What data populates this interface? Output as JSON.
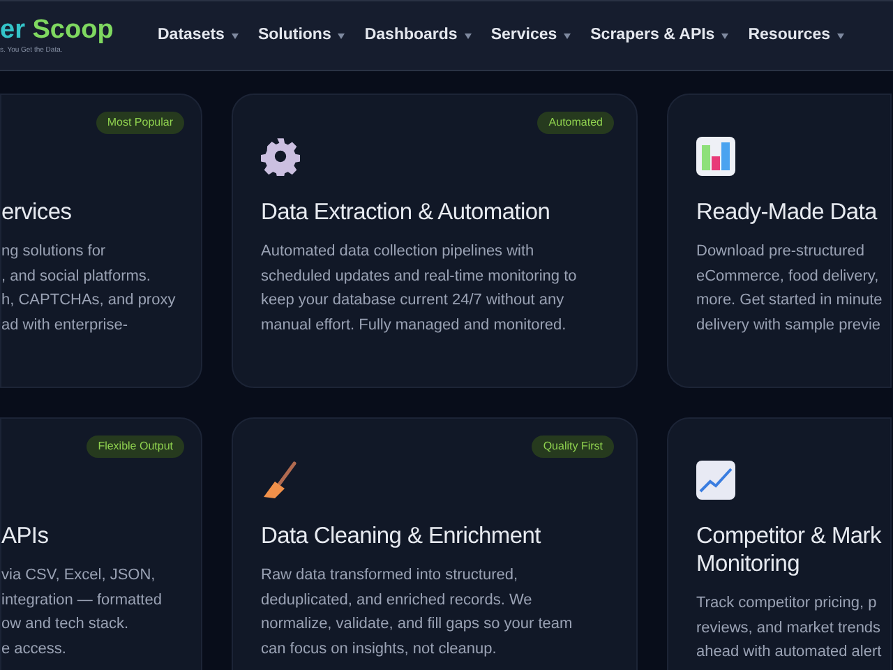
{
  "header": {
    "logo": {
      "part_1": "er",
      "part_2": "Scoop",
      "tagline": "s. You Get the Data."
    },
    "nav": [
      {
        "label": "Datasets"
      },
      {
        "label": "Solutions"
      },
      {
        "label": "Dashboards"
      },
      {
        "label": "Services"
      },
      {
        "label": "Scrapers & APIs"
      },
      {
        "label": "Resources"
      }
    ]
  },
  "cards": [
    {
      "badge": "Most Popular",
      "kind": "plain",
      "title": [
        "ervices"
      ],
      "description": [
        "ng solutions for",
        ", and social platforms.",
        "h, CAPTCHAs, and proxy",
        "ad with enterprise-"
      ]
    },
    {
      "badge": "Automated",
      "kind": "gear",
      "title": [
        "Data Extraction & Automation"
      ],
      "description": [
        "Automated data collection pipelines with",
        "scheduled updates and real-time monitoring to",
        "keep your database current 24/7 without any",
        "manual effort. Fully managed and monitored."
      ]
    },
    {
      "kind": "bars",
      "title": [
        "Ready-Made Data"
      ],
      "description": [
        "Download pre-structured",
        "eCommerce, food delivery,",
        "more. Get started in minute",
        "delivery with sample previe"
      ]
    },
    {
      "badge": "Flexible Output",
      "kind": "plain",
      "title": [
        "APIs"
      ],
      "description": [
        "via CSV, Excel, JSON,",
        "integration — formatted",
        "ow and tech stack.",
        "e access."
      ]
    },
    {
      "badge": "Quality First",
      "kind": "broom",
      "title": [
        "Data Cleaning & Enrichment"
      ],
      "description": [
        "Raw data transformed into structured,",
        "deduplicated, and enriched records. We",
        "normalize, validate, and fill gaps so your team",
        "can focus on insights, not cleanup."
      ]
    },
    {
      "kind": "trend",
      "title": [
        "Competitor & Mark",
        "Monitoring"
      ],
      "description": [
        "Track competitor pricing, p",
        "reviews, and market trends",
        "ahead with automated alert"
      ]
    }
  ]
}
